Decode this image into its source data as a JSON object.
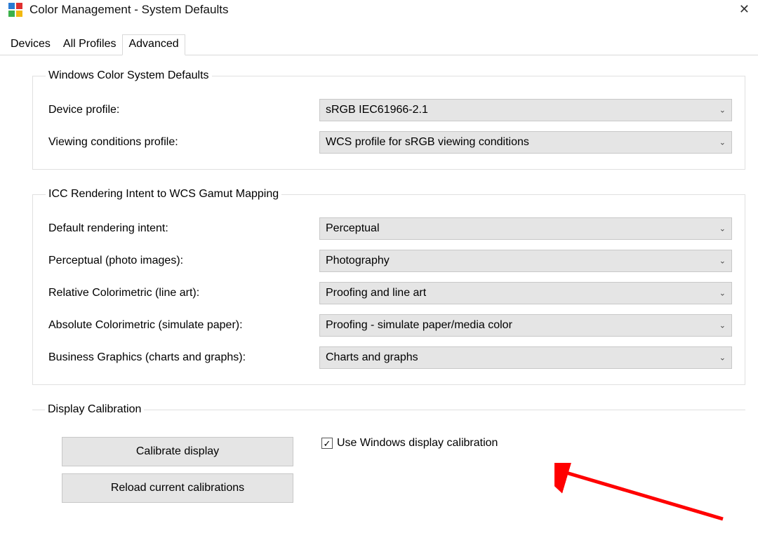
{
  "window": {
    "title": "Color Management - System Defaults"
  },
  "tabs": {
    "devices": "Devices",
    "all_profiles": "All Profiles",
    "advanced": "Advanced"
  },
  "groups": {
    "wcs_defaults": {
      "legend": "Windows Color System Defaults",
      "device_profile_label": "Device profile:",
      "device_profile_value": "sRGB IEC61966-2.1",
      "viewing_label": "Viewing conditions profile:",
      "viewing_value": "WCS profile for sRGB viewing conditions"
    },
    "icc_mapping": {
      "legend": "ICC Rendering Intent to WCS Gamut Mapping",
      "default_intent_label": "Default rendering intent:",
      "default_intent_value": "Perceptual",
      "perceptual_label": "Perceptual (photo images):",
      "perceptual_value": "Photography",
      "relcol_label": "Relative Colorimetric (line art):",
      "relcol_value": "Proofing and line art",
      "abscol_label": "Absolute Colorimetric (simulate paper):",
      "abscol_value": "Proofing - simulate paper/media color",
      "business_label": "Business Graphics (charts and graphs):",
      "business_value": "Charts and graphs"
    },
    "calibration": {
      "legend": "Display Calibration",
      "calibrate_btn": "Calibrate display",
      "reload_btn": "Reload current calibrations",
      "use_windows_label": "Use Windows display calibration",
      "use_windows_checked": true
    }
  }
}
